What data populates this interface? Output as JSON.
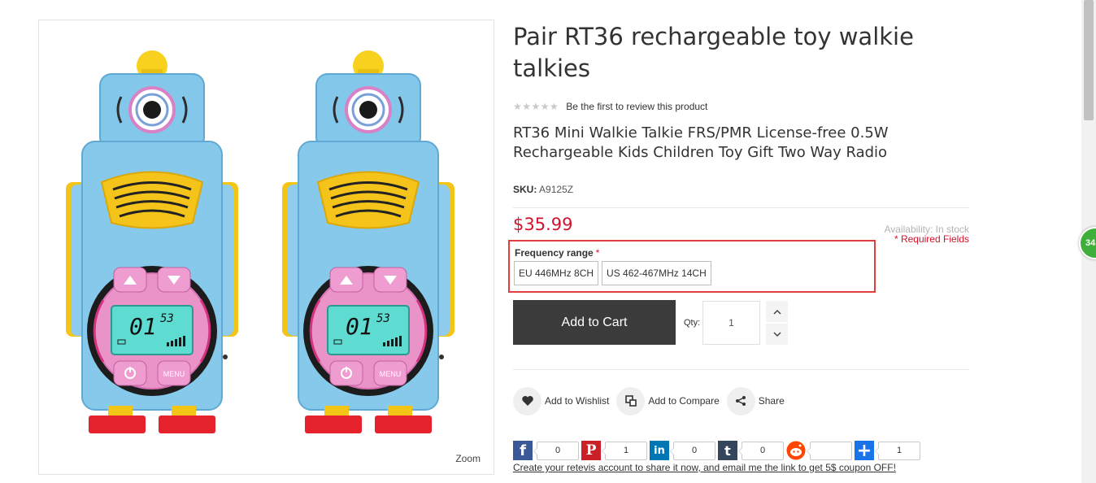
{
  "product": {
    "title": "Pair RT36 rechargeable toy walkie talkies",
    "rating_stars": "★★★★★",
    "review_prompt": "Be the first to review this product",
    "subtitle": "RT36 Mini Walkie Talkie FRS/PMR License-free 0.5W Rechargeable Kids Children Toy Gift Two Way Radio",
    "sku_label": "SKU:",
    "sku_value": "A9125Z",
    "price": "$35.99",
    "availability": "Availability: In stock",
    "required_fields": "* Required Fields"
  },
  "gallery": {
    "zoom_label": "Zoom",
    "lcd_digits": "01",
    "lcd_small_digits": "53",
    "menu_label": "MENU"
  },
  "frequency": {
    "label": "Frequency range",
    "required_mark": "*",
    "options": [
      "EU 446MHz 8CH",
      "US 462-467MHz 14CH"
    ]
  },
  "cart": {
    "add_to_cart_label": "Add to Cart",
    "qty_label": "Qty:",
    "qty_value": "1"
  },
  "actions": {
    "wishlist_label": "Add to Wishlist",
    "compare_label": "Add to Compare",
    "share_label": "Share"
  },
  "share_counts": {
    "facebook": "0",
    "pinterest": "1",
    "linkedin": "0",
    "tumblr": "0",
    "reddit": "",
    "addthis": "1"
  },
  "coupon_text": "Create your retevis account to share it now, and email me the link to get 5$ coupon OFF!",
  "floating_badge": "34",
  "colors": {
    "price": "#d3132b",
    "cart_button": "#3b3b3b",
    "highlight_border": "#e0403d",
    "facebook": "#3b5998",
    "pinterest": "#cb2027",
    "linkedin": "#0077b5",
    "tumblr": "#35465c",
    "reddit": "#ff4500",
    "addthis": "#1a73e8",
    "badge": "#3fae3a"
  }
}
